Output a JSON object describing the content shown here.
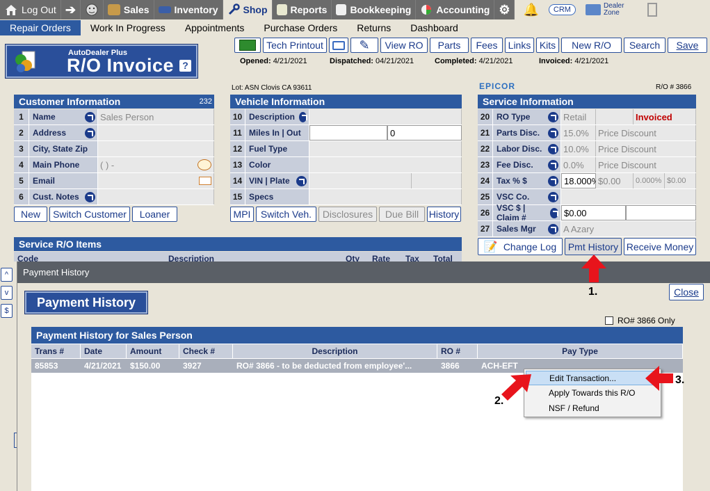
{
  "topnav": {
    "logout": "Log Out",
    "sales": "Sales",
    "inventory": "Inventory",
    "shop": "Shop",
    "reports": "Reports",
    "bookkeeping": "Bookkeeping",
    "accounting": "Accounting",
    "crm": "CRM",
    "dealer_zone_1": "Dealer",
    "dealer_zone_2": "Zone"
  },
  "subnav": [
    "Repair Orders",
    "Work In Progress",
    "Appointments",
    "Purchase Orders",
    "Returns",
    "Dashboard"
  ],
  "title": {
    "small": "AutoDealer Plus",
    "big": "R/O Invoice",
    "help": "?"
  },
  "toolbar": {
    "tech_printout": "Tech Printout",
    "view_ro": "View RO",
    "parts": "Parts",
    "fees": "Fees",
    "links": "Links",
    "kits": "Kits",
    "new_ro": "New R/O",
    "search": "Search",
    "save": "Save"
  },
  "dates": {
    "opened_label": "Opened:",
    "opened": "4/21/2021",
    "dispatched_label": "Dispatched:",
    "dispatched": "04/21/2021",
    "completed_label": "Completed:",
    "completed": "4/21/2021",
    "invoiced_label": "Invoiced:",
    "invoiced": "4/21/2021"
  },
  "lot": "Lot: ASN Clovis CA 93611",
  "epicor": "EPICOR",
  "ro_number": "R/O # 3866",
  "customer": {
    "header": "Customer Information",
    "count": "232",
    "rows": [
      {
        "num": "1",
        "label": "Name",
        "value": "Sales Person"
      },
      {
        "num": "2",
        "label": "Address",
        "value": ""
      },
      {
        "num": "3",
        "label": "City, State Zip",
        "value": ""
      },
      {
        "num": "4",
        "label": "Main Phone",
        "value": "(    )      -"
      },
      {
        "num": "5",
        "label": "Email",
        "value": ""
      },
      {
        "num": "6",
        "label": "Cust. Notes",
        "value": ""
      }
    ],
    "buttons": {
      "new": "New",
      "switch": "Switch Customer",
      "loaner": "Loaner"
    }
  },
  "vehicle": {
    "header": "Vehicle Information",
    "rows": [
      {
        "num": "10",
        "label": "Description",
        "value": ""
      },
      {
        "num": "11",
        "label": "Miles  In | Out",
        "value": "0"
      },
      {
        "num": "12",
        "label": "Fuel Type",
        "value": ""
      },
      {
        "num": "13",
        "label": "Color",
        "value": ""
      },
      {
        "num": "14",
        "label": "VIN | Plate",
        "value": ""
      },
      {
        "num": "15",
        "label": "Specs",
        "value": ""
      }
    ],
    "buttons": {
      "mpi": "MPI",
      "switch": "Switch Veh.",
      "disclosures": "Disclosures",
      "due_bill": "Due Bill",
      "history": "History"
    }
  },
  "service": {
    "header": "Service Information",
    "rows": [
      {
        "num": "20",
        "label": "RO Type",
        "value": "Retail",
        "extra": "Invoiced"
      },
      {
        "num": "21",
        "label": "Parts Disc.",
        "value": "15.0%",
        "extra": "Price Discount"
      },
      {
        "num": "22",
        "label": "Labor Disc.",
        "value": "10.0%",
        "extra": "Price Discount"
      },
      {
        "num": "23",
        "label": "Fee Disc.",
        "value": "0.0%",
        "extra": "Price Discount"
      },
      {
        "num": "24",
        "label": "Tax % $",
        "value": "18.000%",
        "extra": "$0.00",
        "extra2": "0.000%",
        "extra3": "$0.00"
      },
      {
        "num": "25",
        "label": "VSC  Co.",
        "value": ""
      },
      {
        "num": "26",
        "label": "VSC $ | Claim #",
        "value": "$0.00"
      },
      {
        "num": "27",
        "label": "Sales Mgr",
        "value": "A Azary"
      }
    ],
    "buttons": {
      "change_log": "Change Log",
      "pmt_history": "Pmt History",
      "receive_money": "Receive Money"
    }
  },
  "items": {
    "header": "Service R/O Items",
    "cols": [
      "Code",
      "Description",
      "Qty",
      "Rate",
      "Tax",
      "Total"
    ]
  },
  "side_buttons": [
    "^",
    "v",
    "$"
  ],
  "dialog": {
    "title": "Payment History",
    "heading": "Payment History",
    "close": "Close",
    "ro_only": "RO# 3866 Only",
    "grid_header": "Payment History for Sales Person",
    "columns": [
      "Trans #",
      "Date",
      "Amount",
      "Check #",
      "Description",
      "RO #",
      "Pay Type"
    ],
    "rows": [
      {
        "trans": "85853",
        "date": "4/21/2021",
        "amount": "$150.00",
        "check": "3927",
        "description": "RO# 3866 - to be deducted from employee'...",
        "ro": "3866",
        "pay_type": "ACH-EFT"
      }
    ]
  },
  "context_menu": [
    "Edit Transaction...",
    "Apply Towards this R/O",
    "NSF / Refund"
  ],
  "markers": [
    "1.",
    "2.",
    "3."
  ],
  "colors": {
    "accent": "#2d5aa0",
    "arrow": "#e8141c",
    "invoiced": "#c00000"
  }
}
